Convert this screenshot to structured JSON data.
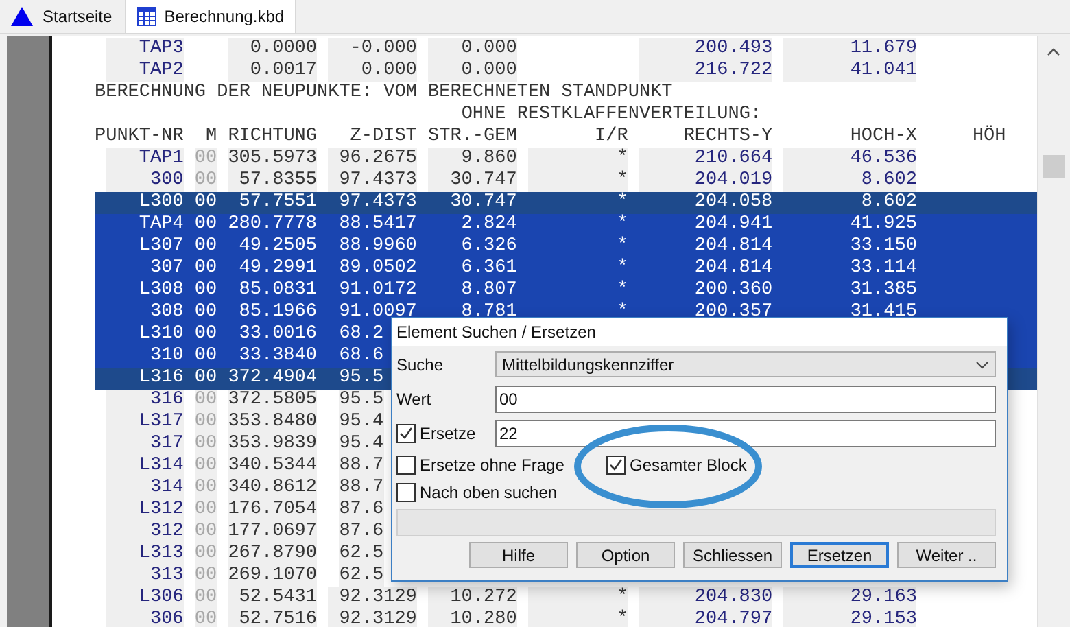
{
  "tabs": [
    {
      "label": "Startseite",
      "selected": false
    },
    {
      "label": "Berechnung.kbd",
      "selected": true
    }
  ],
  "listing": {
    "columns": [
      "PUNKT-NR",
      "M",
      "RICHTUNG",
      "Z-DIST",
      "STR.-GEM",
      "I/R",
      "RECHTS-Y",
      "HOCH-X",
      "HÖH"
    ],
    "rows": [
      {
        "kind": "data",
        "selected": false,
        "id": "TAP3",
        "richtung": "0.0000",
        "zdist": "-0.000",
        "str": "0.000",
        "rechts": "200.493",
        "hoch": "11.679"
      },
      {
        "kind": "data",
        "selected": false,
        "id": "TAP2",
        "richtung": "0.0017",
        "zdist": "0.000",
        "str": "0.000",
        "rechts": "216.722",
        "hoch": "41.041"
      },
      {
        "kind": "title",
        "text": "BERECHNUNG DER NEUPUNKTE: VOM BERECHNETEN STANDPUNKT"
      },
      {
        "kind": "subtitle",
        "text": "OHNE RESTKLAFFENVERTEILUNG:"
      },
      {
        "kind": "header"
      },
      {
        "kind": "data",
        "selected": false,
        "id": "TAP1",
        "m": "00",
        "richtung": "305.5973",
        "zdist": "96.2675",
        "str": "9.860",
        "ir": "*",
        "rechts": "210.664",
        "hoch": "46.536"
      },
      {
        "kind": "data",
        "selected": false,
        "id": "300",
        "m": "00",
        "richtung": "57.8355",
        "zdist": "97.4373",
        "str": "30.747",
        "ir": "*",
        "rechts": "204.019",
        "hoch": "8.602"
      },
      {
        "kind": "data",
        "selected": true,
        "anchor": true,
        "id": "L300",
        "m": "00",
        "richtung": "57.7551",
        "zdist": "97.4373",
        "str": "30.747",
        "ir": "*",
        "rechts": "204.058",
        "hoch": "8.602"
      },
      {
        "kind": "data",
        "selected": true,
        "anchor": false,
        "id": "TAP4",
        "m": "00",
        "richtung": "280.7778",
        "zdist": "88.5417",
        "str": "2.824",
        "ir": "*",
        "rechts": "204.941",
        "hoch": "41.925"
      },
      {
        "kind": "data",
        "selected": true,
        "anchor": false,
        "id": "L307",
        "m": "00",
        "richtung": "49.2505",
        "zdist": "88.9960",
        "str": "6.326",
        "ir": "*",
        "rechts": "204.814",
        "hoch": "33.150"
      },
      {
        "kind": "data",
        "selected": true,
        "anchor": false,
        "id": "307",
        "m": "00",
        "richtung": "49.2991",
        "zdist": "89.0502",
        "str": "6.361",
        "ir": "*",
        "rechts": "204.814",
        "hoch": "33.114"
      },
      {
        "kind": "data",
        "selected": true,
        "anchor": false,
        "id": "L308",
        "m": "00",
        "richtung": "85.0831",
        "zdist": "91.0172",
        "str": "8.807",
        "ir": "*",
        "rechts": "200.360",
        "hoch": "31.385"
      },
      {
        "kind": "data",
        "selected": true,
        "anchor": false,
        "id": "308",
        "m": "00",
        "richtung": "85.1966",
        "zdist": "91.0097",
        "str": "8.781",
        "ir": "*",
        "rechts": "200.357",
        "hoch": "31.415"
      },
      {
        "kind": "cut",
        "selected": true,
        "anchor": false,
        "id": "L310",
        "m": "00",
        "richtung": "33.0016",
        "zdist": "68.2"
      },
      {
        "kind": "cut",
        "selected": true,
        "anchor": false,
        "id": "310",
        "m": "00",
        "richtung": "33.3840",
        "zdist": "68.6"
      },
      {
        "kind": "cut",
        "selected": true,
        "anchor": true,
        "id": "L316",
        "m": "00",
        "richtung": "372.4904",
        "zdist": "95.5"
      },
      {
        "kind": "cut",
        "selected": false,
        "id": "316",
        "m": "00",
        "richtung": "372.5805",
        "zdist": "95.5"
      },
      {
        "kind": "cut",
        "selected": false,
        "id": "L317",
        "m": "00",
        "richtung": "353.8480",
        "zdist": "95.4"
      },
      {
        "kind": "cut",
        "selected": false,
        "id": "317",
        "m": "00",
        "richtung": "353.9839",
        "zdist": "95.4"
      },
      {
        "kind": "cut",
        "selected": false,
        "id": "L314",
        "m": "00",
        "richtung": "340.5344",
        "zdist": "88.7"
      },
      {
        "kind": "cut",
        "selected": false,
        "id": "314",
        "m": "00",
        "richtung": "340.8612",
        "zdist": "88.7"
      },
      {
        "kind": "cut",
        "selected": false,
        "id": "L312",
        "m": "00",
        "richtung": "176.7054",
        "zdist": "87.6"
      },
      {
        "kind": "cut",
        "selected": false,
        "id": "312",
        "m": "00",
        "richtung": "177.0697",
        "zdist": "87.6"
      },
      {
        "kind": "cut",
        "selected": false,
        "id": "L313",
        "m": "00",
        "richtung": "267.8790",
        "zdist": "62.5"
      },
      {
        "kind": "cut",
        "selected": false,
        "id": "313",
        "m": "00",
        "richtung": "269.1070",
        "zdist": "62.5"
      },
      {
        "kind": "data",
        "selected": false,
        "id": "L306",
        "m": "00",
        "richtung": "52.5431",
        "zdist": "92.3129",
        "str": "10.272",
        "ir": "*",
        "rechts": "204.830",
        "hoch": "29.163"
      },
      {
        "kind": "data",
        "selected": false,
        "id": "306",
        "m": "00",
        "richtung": "52.7516",
        "zdist": "92.3129",
        "str": "10.280",
        "ir": "*",
        "rechts": "204.797",
        "hoch": "29.153"
      }
    ]
  },
  "dialog": {
    "title": "Element Suchen / Ersetzen",
    "search": {
      "label": "Suche",
      "value": "Mittelbildungskennziffer"
    },
    "value": {
      "label": "Wert",
      "value": "00"
    },
    "replace": {
      "label": "Ersetze",
      "checked": true,
      "value": "22"
    },
    "options": [
      {
        "label": "Ersetze ohne Frage",
        "checked": false
      },
      {
        "label": "Gesamter Block",
        "checked": true
      },
      {
        "label": "Nach oben suchen",
        "checked": false
      }
    ],
    "buttons": [
      {
        "label": "Hilfe",
        "default": false
      },
      {
        "label": "Option",
        "default": false
      },
      {
        "label": "Schliessen",
        "default": false
      },
      {
        "label": "Ersetzen",
        "default": true
      },
      {
        "label": "Weiter ..",
        "default": false
      }
    ]
  }
}
